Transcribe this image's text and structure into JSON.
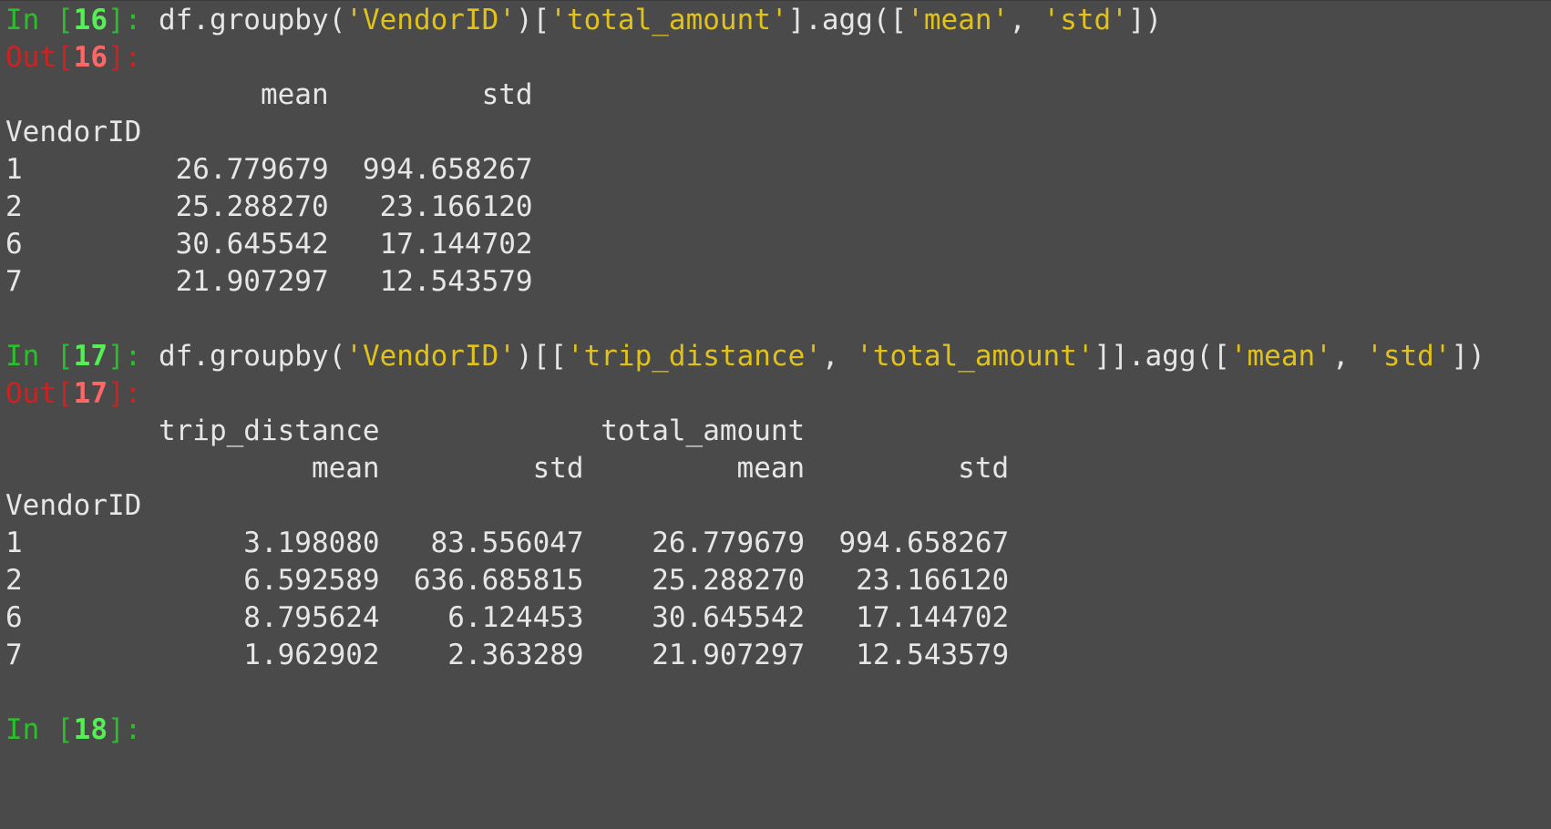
{
  "colors": {
    "background": "#4a4a4a",
    "text": "#e6e6e6",
    "prompt_in": "#2bbf2b",
    "prompt_in_number": "#55ee55",
    "prompt_out": "#cc2222",
    "prompt_out_number": "#ff6666",
    "string": "#e0c21a"
  },
  "cells": [
    {
      "in_prompt": "In [",
      "in_number": "16",
      "in_suffix": "]: ",
      "code": [
        {
          "t": "code",
          "v": "df.groupby("
        },
        {
          "t": "str",
          "v": "'VendorID'"
        },
        {
          "t": "code",
          "v": ")["
        },
        {
          "t": "str",
          "v": "'total_amount'"
        },
        {
          "t": "code",
          "v": "].agg(["
        },
        {
          "t": "str",
          "v": "'mean'"
        },
        {
          "t": "code",
          "v": ", "
        },
        {
          "t": "str",
          "v": "'std'"
        },
        {
          "t": "code",
          "v": "])"
        }
      ],
      "out_prompt": "Out[",
      "out_number": "16",
      "out_suffix": "]:",
      "output_lines": [
        "               mean         std",
        "VendorID",
        "1         26.779679  994.658267",
        "2         25.288270   23.166120",
        "6         30.645542   17.144702",
        "7         21.907297   12.543579"
      ]
    },
    {
      "in_prompt": "In [",
      "in_number": "17",
      "in_suffix": "]: ",
      "code": [
        {
          "t": "code",
          "v": "df.groupby("
        },
        {
          "t": "str",
          "v": "'VendorID'"
        },
        {
          "t": "code",
          "v": ")[["
        },
        {
          "t": "str",
          "v": "'trip_distance'"
        },
        {
          "t": "code",
          "v": ", "
        },
        {
          "t": "str",
          "v": "'total_amount'"
        },
        {
          "t": "code",
          "v": "]].agg(["
        },
        {
          "t": "str",
          "v": "'mean'"
        },
        {
          "t": "code",
          "v": ", "
        },
        {
          "t": "str",
          "v": "'std'"
        },
        {
          "t": "code",
          "v": "])"
        }
      ],
      "out_prompt": "Out[",
      "out_number": "17",
      "out_suffix": "]:",
      "output_lines": [
        "         trip_distance             total_amount",
        "                  mean         std         mean         std",
        "VendorID",
        "1             3.198080   83.556047    26.779679  994.658267",
        "2             6.592589  636.685815    25.288270   23.166120",
        "6             8.795624    6.124453    30.645542   17.144702",
        "7             1.962902    2.363289    21.907297   12.543579"
      ]
    },
    {
      "in_prompt": "In [",
      "in_number": "18",
      "in_suffix": "]: ",
      "code": []
    }
  ]
}
